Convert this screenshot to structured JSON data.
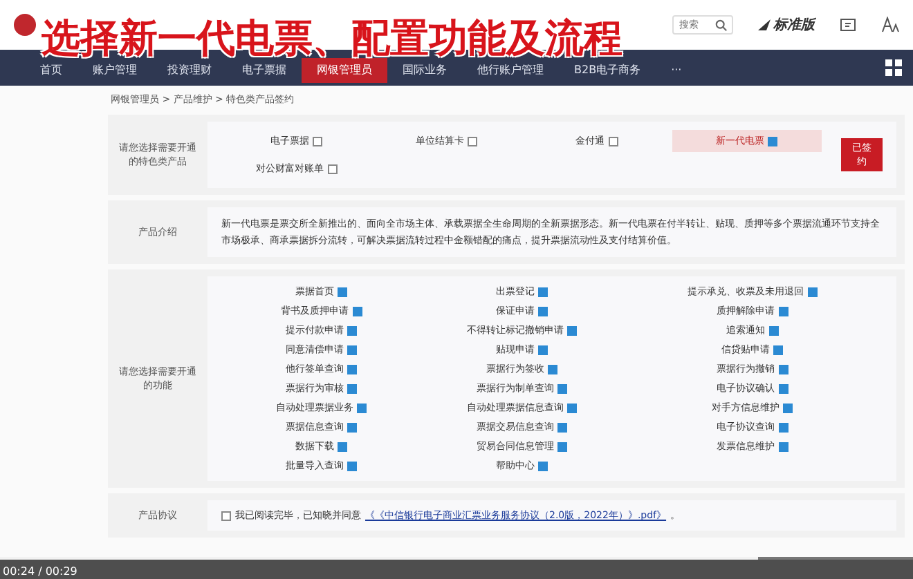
{
  "caption": "选择新一代电票、配置功能及流程",
  "header": {
    "search": {
      "placeholder": "搜索"
    },
    "edition": "标准版"
  },
  "nav": [
    {
      "label": "首页",
      "selected": false
    },
    {
      "label": "账户管理",
      "selected": false
    },
    {
      "label": "投资理财",
      "selected": false
    },
    {
      "label": "电子票据",
      "selected": false
    },
    {
      "label": "网银管理员",
      "selected": true
    },
    {
      "label": "国际业务",
      "selected": false
    },
    {
      "label": "他行账户管理",
      "selected": false
    },
    {
      "label": "B2B电子商务",
      "selected": false
    },
    {
      "label": "···",
      "selected": false
    }
  ],
  "breadcrumb": "网银管理员 > 产品维护 > 特色类产品签约",
  "products": {
    "label": "请您选择需要开通的特色类产品",
    "items": [
      {
        "label": "电子票据",
        "checked": false,
        "selected": false
      },
      {
        "label": "单位结算卡",
        "checked": false,
        "selected": false
      },
      {
        "label": "金付通",
        "checked": false,
        "selected": false
      },
      {
        "label": "新一代电票",
        "checked": true,
        "selected": true
      },
      {
        "label": "对公财富对账单",
        "checked": false,
        "selected": false
      }
    ],
    "button": "已签约"
  },
  "intro": {
    "label": "产品介绍",
    "text": "新一代电票是票交所全新推出的、面向全市场主体、承载票据全生命周期的全新票据形态。新一代电票在付半转让、贴现、质押等多个票据流通环节支持全市场极承、商承票据拆分流转，可解决票据流转过程中金额错配的痛点，提升票据流动性及支付结算价值。"
  },
  "functions": {
    "label": "请您选择需要开通的功能",
    "columns": [
      [
        {
          "label": "票据首页",
          "checked": true
        },
        {
          "label": "背书及质押申请",
          "checked": true
        },
        {
          "label": "提示付款申请",
          "checked": true
        },
        {
          "label": "同意清偿申请",
          "checked": true
        },
        {
          "label": "他行签单查询",
          "checked": true
        },
        {
          "label": "票据行为审核",
          "checked": true
        },
        {
          "label": "自动处理票据业务",
          "checked": true
        },
        {
          "label": "票据信息查询",
          "checked": true
        },
        {
          "label": "数据下载",
          "checked": true
        },
        {
          "label": "批量导入查询",
          "checked": true
        }
      ],
      [
        {
          "label": "出票登记",
          "checked": true
        },
        {
          "label": "保证申请",
          "checked": true
        },
        {
          "label": "不得转让标记撤销申请",
          "checked": true
        },
        {
          "label": "贴现申请",
          "checked": true
        },
        {
          "label": "票据行为签收",
          "checked": true
        },
        {
          "label": "票据行为制单查询",
          "checked": true
        },
        {
          "label": "自动处理票据信息查询",
          "checked": true
        },
        {
          "label": "票据交易信息查询",
          "checked": true
        },
        {
          "label": "贸易合同信息管理",
          "checked": true
        },
        {
          "label": "帮助中心",
          "checked": true
        }
      ],
      [
        {
          "label": "提示承兑、收票及未用退回",
          "checked": true
        },
        {
          "label": "质押解除申请",
          "checked": true
        },
        {
          "label": "追索通知",
          "checked": true
        },
        {
          "label": "信贷贴申请",
          "checked": true
        },
        {
          "label": "票据行为撤销",
          "checked": true
        },
        {
          "label": "电子协议确认",
          "checked": true
        },
        {
          "label": "对手方信息维护",
          "checked": true
        },
        {
          "label": "电子协议查询",
          "checked": true
        },
        {
          "label": "发票信息维护",
          "checked": true
        }
      ]
    ]
  },
  "agreement": {
    "label": "产品协议",
    "checked": false,
    "text": "我已阅读完毕，已知晓并同意",
    "link": "《《中信银行电子商业汇票业务服务协议（2.0版，2022年）》.pdf》",
    "tail": "。"
  },
  "player": {
    "time": "00:24 / 00:29",
    "level": 0.83
  }
}
